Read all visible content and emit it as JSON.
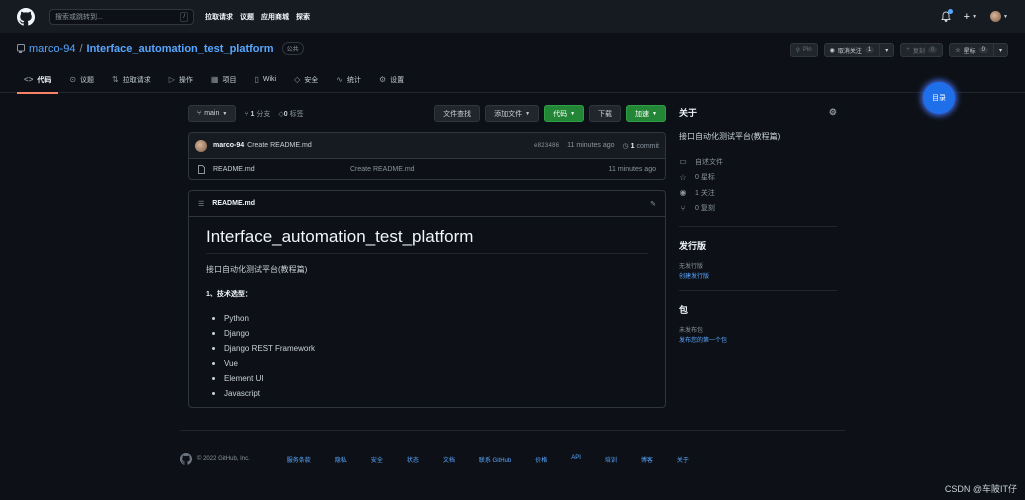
{
  "header": {
    "search_placeholder": "搜索或跳转到...",
    "search_hint": "/",
    "nav": [
      "拉取请求",
      "议题",
      "应用商城",
      "探索"
    ],
    "plus": "+"
  },
  "repo": {
    "owner": "marco-94",
    "sep": "/",
    "name": "Interface_automation_test_platform",
    "visibility": "公共",
    "pin": "Pin",
    "unwatch": "取消关注",
    "watch_count": "1",
    "fork": "复刻",
    "fork_count": "0",
    "star": "星标",
    "star_count": "0"
  },
  "tabs": [
    {
      "label": "代码",
      "icon": "<>"
    },
    {
      "label": "议题",
      "icon": "⊙"
    },
    {
      "label": "拉取请求",
      "icon": "⇅"
    },
    {
      "label": "操作",
      "icon": "▷"
    },
    {
      "label": "项目",
      "icon": "▦"
    },
    {
      "label": "Wiki",
      "icon": "▯"
    },
    {
      "label": "安全",
      "icon": "◇"
    },
    {
      "label": "统计",
      "icon": "∿"
    },
    {
      "label": "设置",
      "icon": "⚙"
    }
  ],
  "toc": "目录",
  "toolbar": {
    "branch": "main",
    "branch_count": "1",
    "branch_label": "分支",
    "tag_count": "0",
    "tag_label": "标签",
    "find_file": "文件查找",
    "add_file": "添加文件",
    "code": "代码",
    "download": "下载",
    "join": "加速"
  },
  "commit": {
    "author": "marco-94",
    "message": "Create README.md",
    "sha": "e823486",
    "age": "11 minutes ago",
    "count": "1",
    "count_label": "commit"
  },
  "files": [
    {
      "name": "README.md",
      "message": "Create README.md",
      "age": "11 minutes ago"
    }
  ],
  "readme": {
    "filename": "README.md",
    "title": "Interface_automation_test_platform",
    "subtitle": "接口自动化测试平台(教程篇)",
    "section": "1、技术选型：",
    "items": [
      "Python",
      "Django",
      "Django REST Framework",
      "Vue",
      "Element UI",
      "Javascript"
    ]
  },
  "sidebar": {
    "about": "关于",
    "description": "接口自动化测试平台(教程篇)",
    "stats": [
      {
        "icon": "▭",
        "text": "自述文件"
      },
      {
        "icon": "☆",
        "text": "0 星标"
      },
      {
        "icon": "◉",
        "text": "1 关注"
      },
      {
        "icon": "⑂",
        "text": "0 复刻"
      }
    ],
    "releases_title": "发行版",
    "releases_none": "无发行版",
    "releases_link": "创建发行版",
    "packages_title": "包",
    "packages_none": "未发布包",
    "packages_link": "发布您的第一个包"
  },
  "footer": {
    "copyright": "© 2022 GitHub, Inc.",
    "links": [
      "服务条款",
      "隐私",
      "安全",
      "状态",
      "文档",
      "联系 GitHub",
      "价格",
      "API",
      "培训",
      "博客",
      "关于"
    ]
  },
  "watermark": "CSDN @车陂IT仔",
  "colors": {
    "accent": "#58a6ff",
    "green": "#238636",
    "tab_underline": "#f78166",
    "bg": "#0d1117"
  }
}
